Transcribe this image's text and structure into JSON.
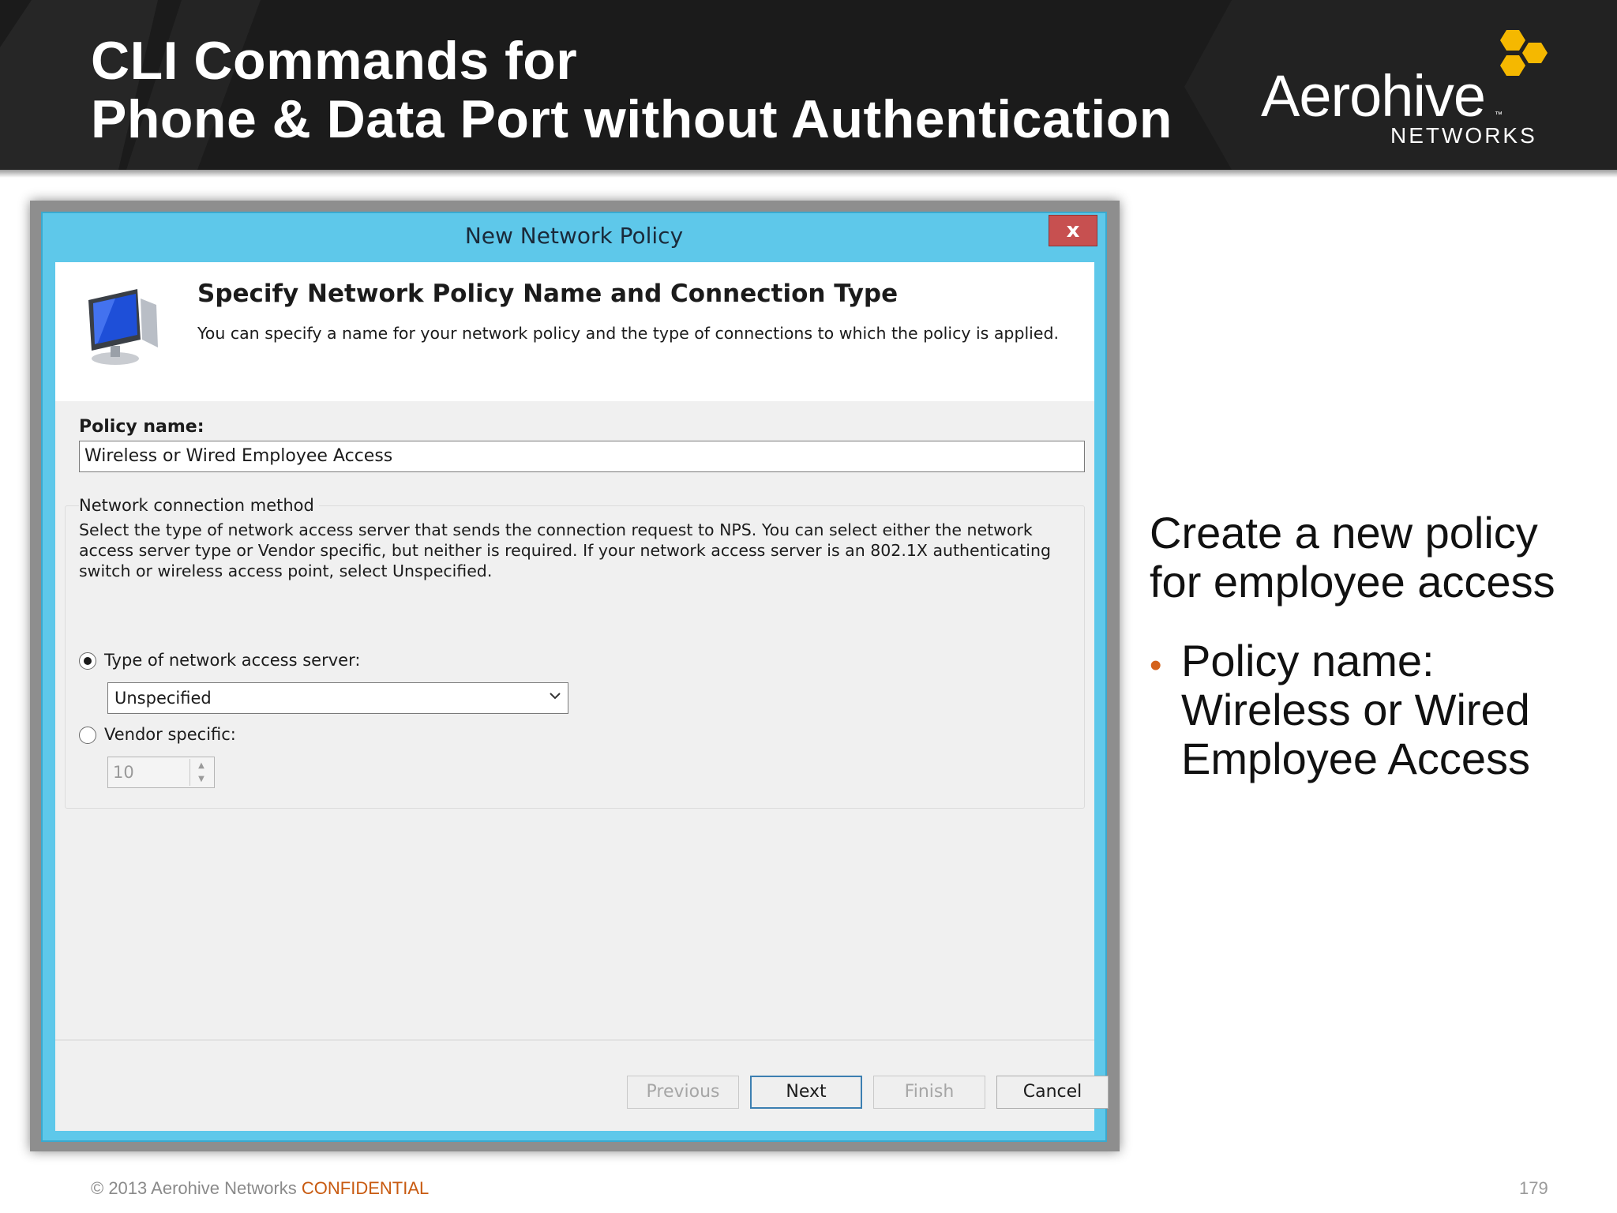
{
  "slide": {
    "title_line1": "CLI Commands for",
    "title_line2": "Phone & Data Port without Authentication",
    "logo_word": "Aerohive",
    "logo_tm": "™",
    "logo_sub": "NETWORKS",
    "colors": {
      "banner": "#1b1b1b",
      "hex_logo": "#f5b800",
      "bullet": "#d4611a",
      "dialog_frame": "#5ec8ea"
    }
  },
  "dialog": {
    "window_title": "New Network Policy",
    "close_label": "x",
    "header_title": "Specify Network Policy Name and Connection Type",
    "header_desc": "You can specify a name for your network policy and the type of connections to which the policy is applied.",
    "icon": "computer-monitor-icon",
    "policy_name_label": "Policy name:",
    "policy_name_value": "Wireless or Wired Employee Access",
    "method_label": "Network connection method",
    "method_desc": "Select the type of network access server that sends the connection request to NPS. You can select either the network access server type or Vendor specific, but neither is required.  If your network access server is an 802.1X authenticating switch or wireless access point, select Unspecified.",
    "radio_type_label": "Type of network access server:",
    "radio_type_checked": true,
    "server_type_selected": "Unspecified",
    "radio_vendor_label": "Vendor specific:",
    "radio_vendor_checked": false,
    "vendor_value": "10",
    "buttons": {
      "previous": "Previous",
      "next": "Next",
      "finish": "Finish",
      "cancel": "Cancel"
    }
  },
  "side": {
    "heading": "Create a new policy for employee access",
    "bullet_symbol": "•",
    "bullet": "Policy name: Wireless or Wired Employee Access"
  },
  "footer": {
    "copyright": "© 2013 Aerohive Networks ",
    "confidential": "CONFIDENTIAL",
    "page_number": "179"
  }
}
